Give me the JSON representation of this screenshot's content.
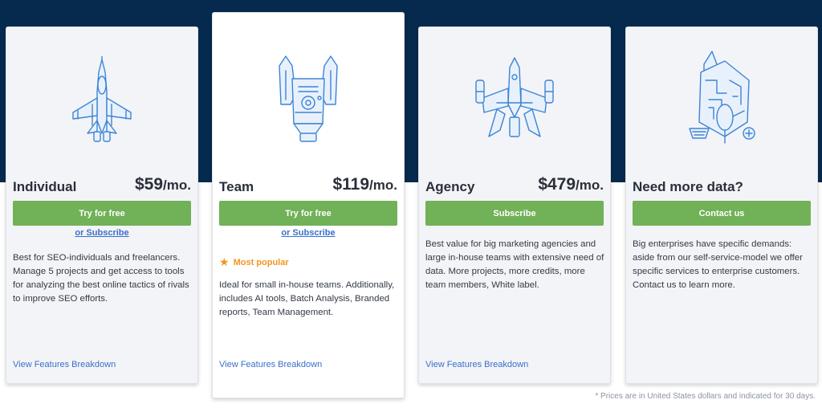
{
  "plans": [
    {
      "title": "Individual",
      "price": "$59",
      "unit": "/mo.",
      "button": "Try for free",
      "subscribe": "or Subscribe",
      "description": "Best for SEO-individuals and freelancers. Manage 5 projects and get access to tools for analyzing the best online tactics of rivals to improve SEO efforts.",
      "features_link": "View Features Breakdown",
      "illustration": "fighter-jet-icon"
    },
    {
      "title": "Team",
      "price": "$119",
      "unit": "/mo.",
      "button": "Try for free",
      "subscribe": "or Subscribe",
      "badge": "Most popular",
      "description": "Ideal for small in-house teams. Additionally, includes AI tools, Batch Analysis, Branded reports, Team Management.",
      "features_link": "View Features Breakdown",
      "illustration": "spaceship-icon"
    },
    {
      "title": "Agency",
      "price": "$479",
      "unit": "/mo.",
      "button": "Subscribe",
      "description": "Best value for big marketing agencies and large in-house teams with extensive need of data. More projects, more credits, more team members, White label.",
      "features_link": "View Features Breakdown",
      "illustration": "cruiser-ship-icon"
    },
    {
      "title": "Need more data?",
      "button": "Contact us",
      "description": "Big enterprises have specific demands: aside from our self-service-model we offer specific services to enterprise customers. Contact us to learn more.",
      "illustration": "mothership-icon"
    }
  ],
  "footnote": "* Prices are in United States dollars and indicated for 30 days.",
  "colors": {
    "header_band": "#062a4e",
    "button_green": "#71b157",
    "link_blue": "#3b6fc9",
    "popular_orange": "#f0961f",
    "icon_blue": "#3d84d6"
  }
}
